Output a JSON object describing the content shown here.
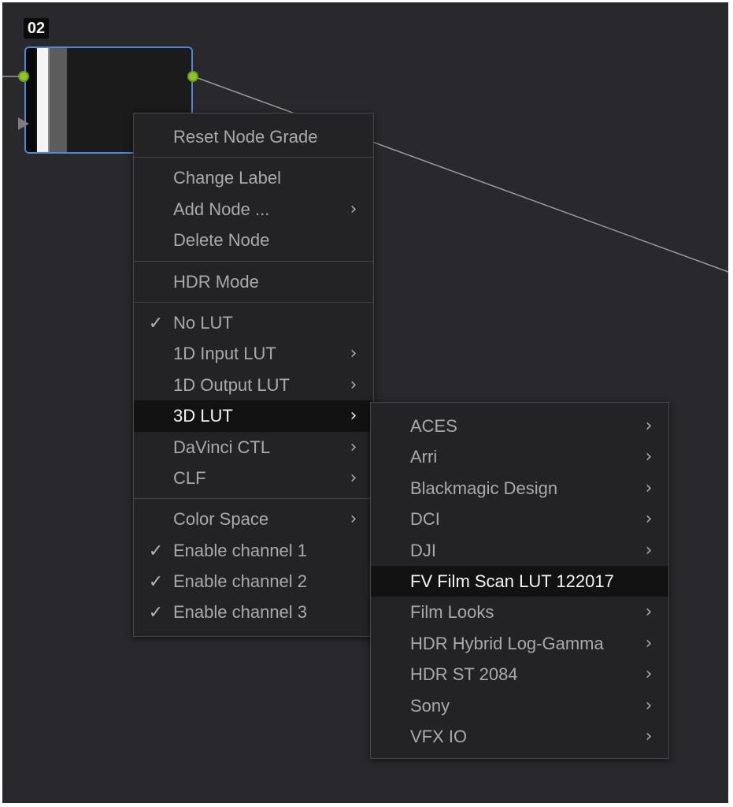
{
  "node": {
    "label": "02"
  },
  "context_menu": {
    "groups": [
      [
        {
          "label": "Reset Node Grade",
          "submenu": false,
          "checked": false
        }
      ],
      [
        {
          "label": "Change Label",
          "submenu": false,
          "checked": false
        },
        {
          "label": "Add Node ...",
          "submenu": true,
          "checked": false
        },
        {
          "label": "Delete Node",
          "submenu": false,
          "checked": false
        }
      ],
      [
        {
          "label": "HDR Mode",
          "submenu": false,
          "checked": false
        }
      ],
      [
        {
          "label": "No LUT",
          "submenu": false,
          "checked": true
        },
        {
          "label": "1D Input LUT",
          "submenu": true,
          "checked": false
        },
        {
          "label": "1D Output LUT",
          "submenu": true,
          "checked": false
        },
        {
          "label": "3D LUT",
          "submenu": true,
          "checked": false,
          "highlighted": true
        },
        {
          "label": "DaVinci CTL",
          "submenu": true,
          "checked": false
        },
        {
          "label": "CLF",
          "submenu": true,
          "checked": false
        }
      ],
      [
        {
          "label": "Color Space",
          "submenu": true,
          "checked": false
        },
        {
          "label": "Enable channel 1",
          "submenu": false,
          "checked": true
        },
        {
          "label": "Enable channel 2",
          "submenu": false,
          "checked": true
        },
        {
          "label": "Enable channel 3",
          "submenu": false,
          "checked": true
        }
      ]
    ]
  },
  "lut_submenu": {
    "items": [
      {
        "label": "ACES",
        "submenu": true
      },
      {
        "label": "Arri",
        "submenu": true
      },
      {
        "label": "Blackmagic Design",
        "submenu": true
      },
      {
        "label": "DCI",
        "submenu": true
      },
      {
        "label": "DJI",
        "submenu": true
      },
      {
        "label": "FV Film Scan LUT 122017",
        "submenu": false,
        "highlighted": true
      },
      {
        "label": "Film Looks",
        "submenu": true
      },
      {
        "label": "HDR Hybrid Log-Gamma",
        "submenu": true
      },
      {
        "label": "HDR ST 2084",
        "submenu": true
      },
      {
        "label": "Sony",
        "submenu": true
      },
      {
        "label": "VFX IO",
        "submenu": true
      }
    ]
  },
  "glyphs": {
    "check": "✓",
    "submenu_arrow": "›"
  },
  "colors": {
    "canvas": "#29292d",
    "node_border": "#4f88d6",
    "port": "#8dc626",
    "menu_bg": "#232325",
    "highlight_bg": "#121213"
  }
}
